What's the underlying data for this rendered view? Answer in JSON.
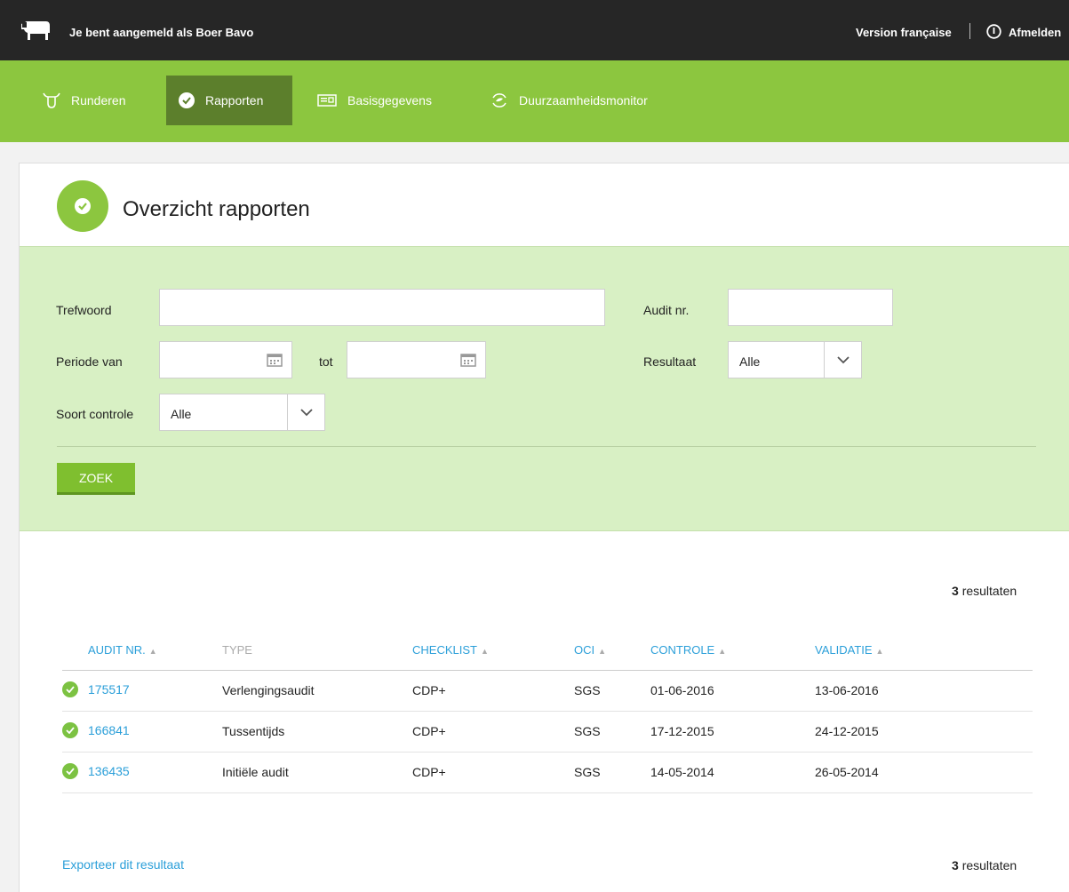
{
  "topbar": {
    "user_text": "Je bent aangemeld als Boer Bavo",
    "language_link": "Version française",
    "logout_label": "Afmelden"
  },
  "nav": {
    "items": [
      {
        "label": "Runderen",
        "icon": "cow-head-icon"
      },
      {
        "label": "Rapporten",
        "icon": "check-circle-icon",
        "active": true
      },
      {
        "label": "Basisgegevens",
        "icon": "id-card-icon"
      },
      {
        "label": "Duurzaamheidsmonitor",
        "icon": "sustainability-icon"
      }
    ]
  },
  "page": {
    "title": "Overzicht rapporten"
  },
  "filters": {
    "keyword_label": "Trefwoord",
    "keyword_value": "",
    "audit_label": "Audit nr.",
    "audit_value": "",
    "period_from_label": "Periode van",
    "period_to_label": "tot",
    "result_label": "Resultaat",
    "result_value": "Alle",
    "control_type_label": "Soort controle",
    "control_type_value": "Alle",
    "search_button": "ZOEK"
  },
  "results": {
    "count": "3",
    "count_suffix": "resultaten",
    "columns": [
      "AUDIT NR.",
      "TYPE",
      "CHECKLIST",
      "OCI",
      "CONTROLE",
      "VALIDATIE"
    ],
    "rows": [
      {
        "audit": "175517",
        "type": "Verlengingsaudit",
        "checklist": "CDP+",
        "oci": "SGS",
        "controle": "01-06-2016",
        "validatie": "13-06-2016"
      },
      {
        "audit": "166841",
        "type": "Tussentijds",
        "checklist": "CDP+",
        "oci": "SGS",
        "controle": "17-12-2015",
        "validatie": "24-12-2015"
      },
      {
        "audit": "136435",
        "type": "Initiële audit",
        "checklist": "CDP+",
        "oci": "SGS",
        "controle": "14-05-2014",
        "validatie": "26-05-2014"
      }
    ],
    "export_link": "Exporteer dit resultaat"
  },
  "colors": {
    "brand_green": "#8cc63f",
    "nav_active": "#5c7f2c",
    "filter_bg": "#d8f0c4",
    "link_blue": "#2b9fd9",
    "topbar_bg": "#262626"
  }
}
